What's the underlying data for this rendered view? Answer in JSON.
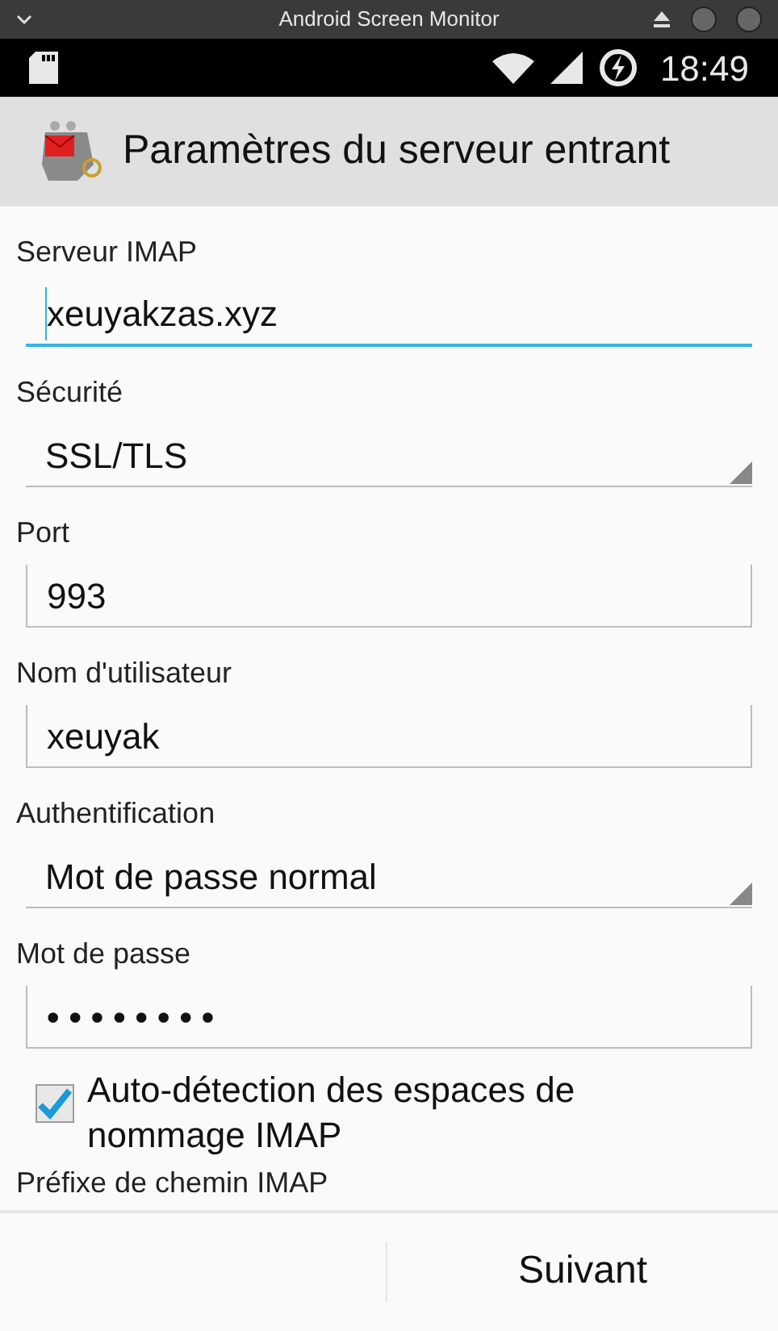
{
  "window": {
    "title": "Android Screen Monitor"
  },
  "status_bar": {
    "time": "18:49"
  },
  "action_bar": {
    "title": "Paramètres du serveur entrant"
  },
  "fields": [
    {
      "kind": "text",
      "label": "Serveur IMAP",
      "value": "xeuyakzas.xyz",
      "focused": true
    },
    {
      "kind": "dropdown",
      "label": "Sécurité",
      "value": "SSL/TLS",
      "focused": false
    },
    {
      "kind": "text",
      "label": "Port",
      "value": "993",
      "focused": false
    },
    {
      "kind": "text",
      "label": "Nom d'utilisateur",
      "value": "xeuyak",
      "focused": false
    },
    {
      "kind": "dropdown",
      "label": "Authentification",
      "value": "Mot de passe normal",
      "focused": false
    },
    {
      "kind": "password",
      "label": "Mot de passe",
      "value": "••••••••",
      "focused": false
    }
  ],
  "checkbox": {
    "label": "Auto-détection des espaces de nommage IMAP",
    "checked": true
  },
  "cut_label": "Préfixe de chemin IMAP",
  "buttons": [
    "Suivant"
  ]
}
